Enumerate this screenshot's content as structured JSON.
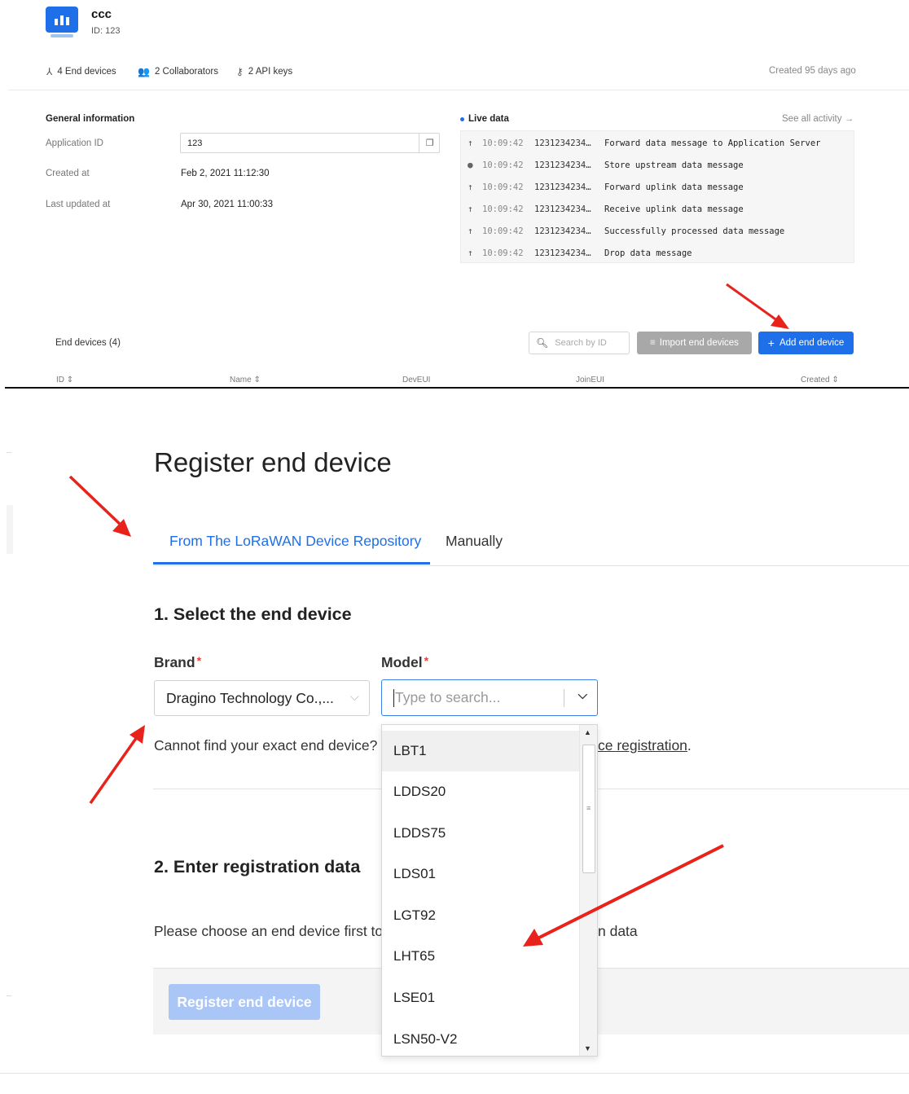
{
  "app": {
    "name": "ccc",
    "id_line": "ID: 123"
  },
  "stats": {
    "end_devices": "4 End devices",
    "collaborators": "2 Collaborators",
    "api_keys": "2 API keys",
    "created": "Created 95 days ago"
  },
  "general": {
    "title": "General information",
    "application_id_label": "Application ID",
    "application_id_value": "123",
    "created_at_label": "Created at",
    "created_at_value": "Feb 2, 2021 11:12:30",
    "updated_at_label": "Last updated at",
    "updated_at_value": "Apr 30, 2021 11:00:33"
  },
  "live": {
    "title": "Live data",
    "see_all": "See all activity →",
    "events": [
      {
        "icon": "arrow-up-icon",
        "time": "10:09:42",
        "device": "1231234234…",
        "message": "Forward data message to Application Server"
      },
      {
        "icon": "info-icon",
        "time": "10:09:42",
        "device": "1231234234…",
        "message": "Store upstream data message"
      },
      {
        "icon": "arrow-up-icon",
        "time": "10:09:42",
        "device": "1231234234…",
        "message": "Forward uplink data message"
      },
      {
        "icon": "arrow-up-icon",
        "time": "10:09:42",
        "device": "1231234234…",
        "message": "Receive uplink data message"
      },
      {
        "icon": "arrow-up-icon",
        "time": "10:09:42",
        "device": "1231234234…",
        "message": "Successfully processed data message"
      },
      {
        "icon": "arrow-up-icon",
        "time": "10:09:42",
        "device": "1231234234…",
        "message": "Drop data message"
      }
    ]
  },
  "devices_table": {
    "title": "End devices (4)",
    "search_placeholder": "Search by ID",
    "import_label": "Import end devices",
    "add_label": "Add end device",
    "columns": [
      "ID",
      "Name",
      "DevEUI",
      "JoinEUI",
      "Created"
    ]
  },
  "register": {
    "title": "Register end device",
    "tabs": [
      "From The LoRaWAN Device Repository",
      "Manually"
    ],
    "step1": "1. Select the end device",
    "brand_label": "Brand",
    "brand_value": "Dragino Technology Co.,...",
    "model_label": "Model",
    "model_placeholder": "Type to search...",
    "hint_start": "Cannot find your exact end device? ",
    "hint_link": "ce registration",
    "hint_end": ".",
    "step2": "2. Enter registration data",
    "para_start": "Please choose an end device first to",
    "para_end": "n data",
    "register_button": "Register end device",
    "footer": "...",
    "model_options": [
      "LBT1",
      "LDDS20",
      "LDDS75",
      "LDS01",
      "LGT92",
      "LHT65",
      "LSE01",
      "LSN50-V2"
    ]
  },
  "colors": {
    "accent": "#1e6fe8",
    "annotation_arrow": "#e8231b",
    "required": "#e0463c"
  }
}
